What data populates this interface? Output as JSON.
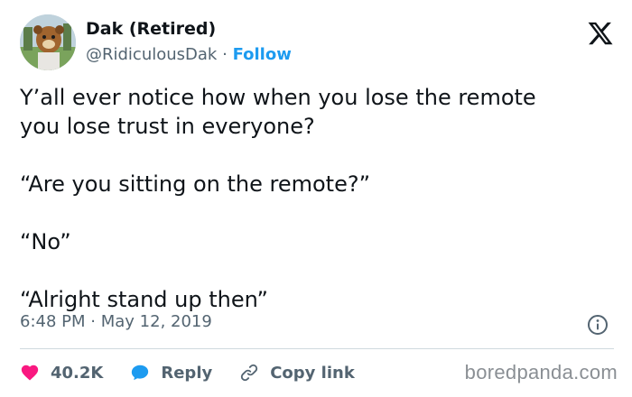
{
  "author": {
    "display_name": "Dak (Retired)",
    "handle": "@RidiculousDak",
    "separator": "·",
    "follow_label": "Follow"
  },
  "brand": {
    "logo": "x-logo-icon",
    "color": "#0f1419"
  },
  "tweet": {
    "lines": [
      "Y’all ever notice how when you lose the remote",
      "you lose trust in everyone?",
      "“Are you sitting on the remote?”",
      "“No”",
      "“Alright stand up then”"
    ],
    "time": "6:48 PM",
    "separator": "·",
    "date": "May 12, 2019"
  },
  "actions": {
    "likes": "40.2K",
    "reply_label": "Reply",
    "copy_link_label": "Copy link"
  },
  "colors": {
    "like": "#f91880",
    "reply": "#1d9bf0",
    "link": "#1d9bf0",
    "muted": "#536471"
  },
  "watermark": "boredpanda.com"
}
